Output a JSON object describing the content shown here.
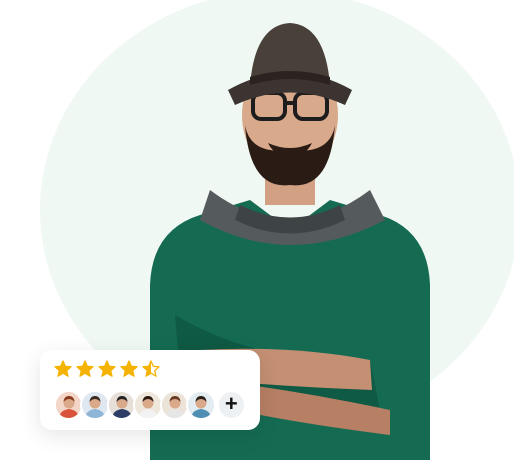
{
  "rating": {
    "value": 4.5,
    "max": 5,
    "star_color": "#f5b301",
    "star_icon": "star-icon",
    "avatars": [
      {
        "bg": "#f3d6c8",
        "hair": "#8a3b1e",
        "shirt": "#d9523c"
      },
      {
        "bg": "#dfe8f1",
        "hair": "#3a2a20",
        "shirt": "#8fb5d6"
      },
      {
        "bg": "#e7e0d8",
        "hair": "#222222",
        "shirt": "#2c3e66"
      },
      {
        "bg": "#efe6dc",
        "hair": "#2a1a12",
        "shirt": "#f2f2f2"
      },
      {
        "bg": "#ece3d9",
        "hair": "#6b3b22",
        "shirt": "#e6e6e6"
      },
      {
        "bg": "#e3ecf0",
        "hair": "#2b2118",
        "shirt": "#4e8fb3"
      }
    ],
    "more": {
      "label": "+",
      "icon": "plus-icon"
    }
  },
  "theme": {
    "accent_bg": "#f0f8f4",
    "sweater": "#156b52"
  }
}
